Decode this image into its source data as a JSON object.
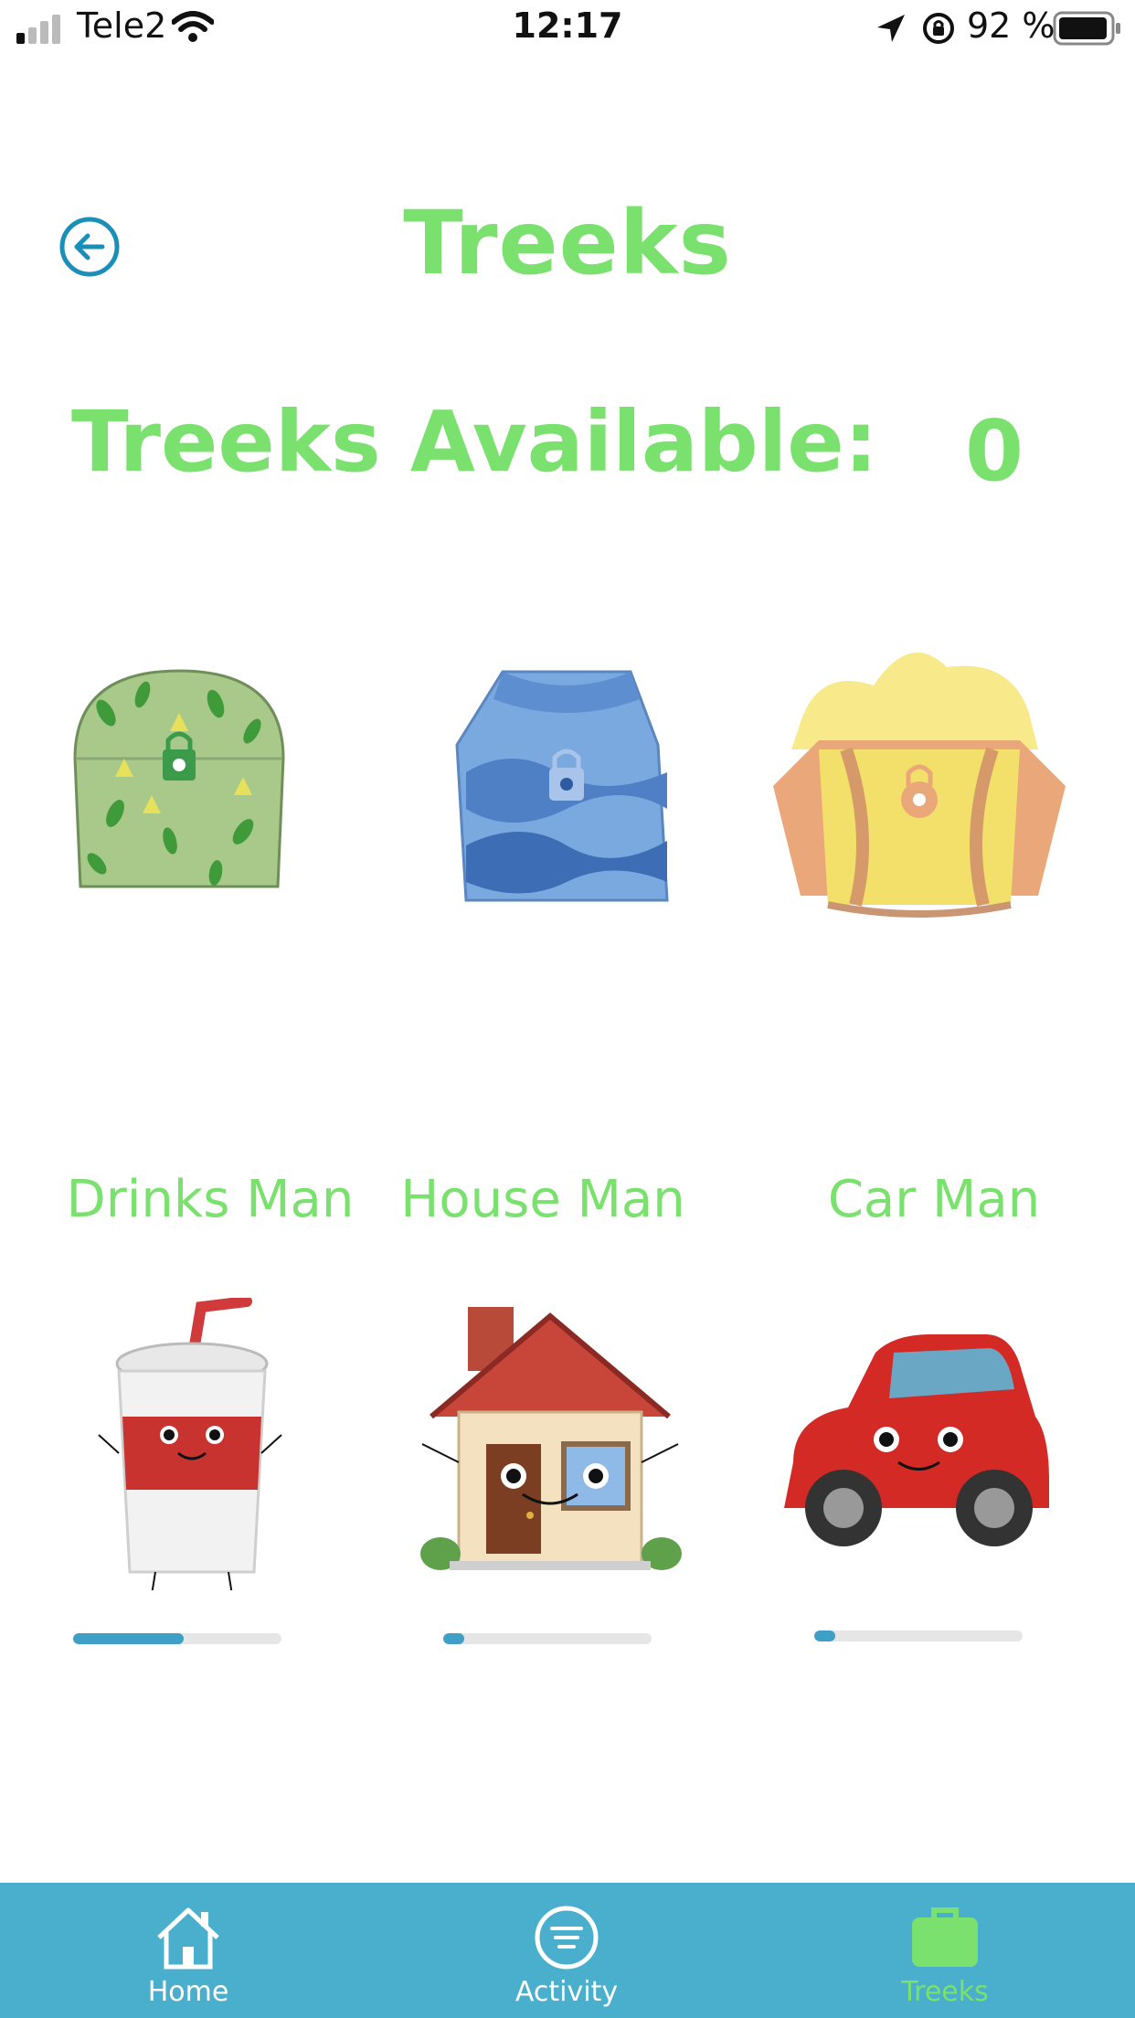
{
  "status_bar": {
    "carrier": "Tele2",
    "time": "12:17",
    "battery": "92 %"
  },
  "header": {
    "title": "Treeks",
    "back_icon": "arrow-left-circle-icon"
  },
  "availability": {
    "label": "Treeks Available:",
    "value": "0"
  },
  "chests": [
    {
      "name": "leaf-chest",
      "locked": true
    },
    {
      "name": "wave-chest",
      "locked": true
    },
    {
      "name": "sun-chest",
      "locked": true
    }
  ],
  "characters": [
    {
      "name": "Drinks Man",
      "progress": 0.53
    },
    {
      "name": "House Man",
      "progress": 0.1
    },
    {
      "name": "Car Man",
      "progress": 0.1
    }
  ],
  "tabs": [
    {
      "label": "Home",
      "icon": "house-icon",
      "active": false
    },
    {
      "label": "Activity",
      "icon": "list-circle-icon",
      "active": false
    },
    {
      "label": "Treeks",
      "icon": "briefcase-icon",
      "active": true
    }
  ],
  "colors": {
    "accent_green": "#7be16e",
    "tab_bar": "#4aaecd",
    "progress_fill": "#3f9fc7",
    "back_icon": "#1a8fb8"
  }
}
